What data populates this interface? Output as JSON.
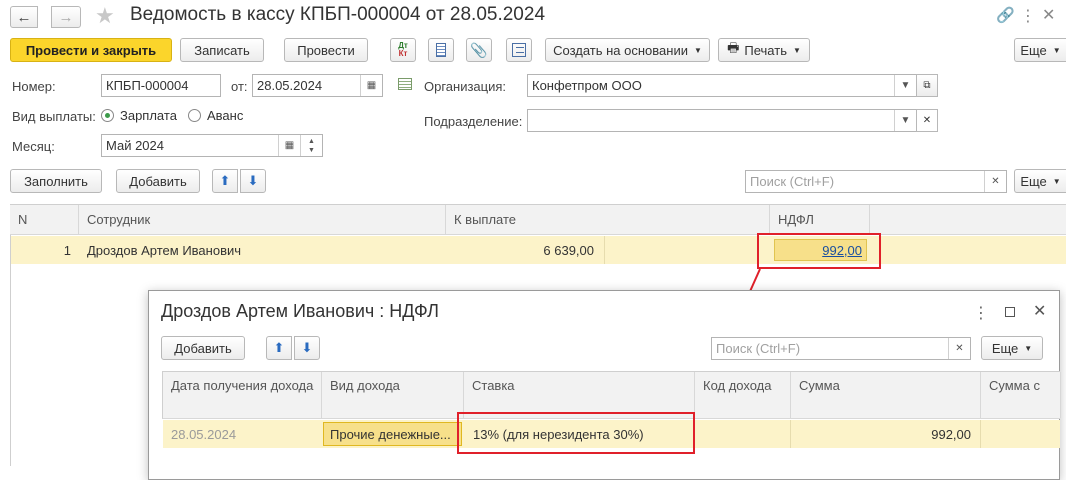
{
  "window": {
    "title": "Ведомость в кассу КПБП-000004 от 28.05.2024"
  },
  "toolbar": {
    "post_close": "Провести и закрыть",
    "save": "Записать",
    "post": "Провести",
    "dt_kt_top": "Дт",
    "dt_kt_bottom": "Кт",
    "create_based": "Создать на основании",
    "print": "Печать",
    "more": "Еще"
  },
  "form": {
    "number_label": "Номер:",
    "number_value": "КПБП-000004",
    "date_label": "от:",
    "date_value": "28.05.2024",
    "org_label": "Организация:",
    "org_value": "Конфетпром ООО",
    "payment_type_label": "Вид выплаты:",
    "payment_options": [
      "Зарплата",
      "Аванс"
    ],
    "department_label": "Подразделение:",
    "department_value": "",
    "month_label": "Месяц:",
    "month_value": "Май 2024"
  },
  "table_toolbar": {
    "fill": "Заполнить",
    "add": "Добавить",
    "search_placeholder": "Поиск (Ctrl+F)",
    "more": "Еще"
  },
  "table": {
    "columns": [
      "N",
      "Сотрудник",
      "К выплате",
      "НДФЛ"
    ],
    "rows": [
      {
        "n": "1",
        "employee": "Дроздов Артем Иванович",
        "to_pay": "6 639,00",
        "ndfl": "992,00"
      }
    ]
  },
  "dialog": {
    "title": "Дроздов Артем Иванович : НДФЛ",
    "add": "Добавить",
    "search_placeholder": "Поиск (Ctrl+F)",
    "more": "Еще",
    "columns": [
      "Дата получения дохода",
      "Вид дохода",
      "Ставка",
      "Код дохода",
      "Сумма",
      "Сумма с"
    ],
    "rows": [
      {
        "date": "28.05.2024",
        "income_type": "Прочие денежные...",
        "rate": "13% (для нерезидента 30%)",
        "code": "",
        "sum": "992,00"
      }
    ]
  },
  "colors": {
    "primary_button": "#fbd52b",
    "selected_row": "#fcf3c9",
    "highlight_red": "#e0202a",
    "radio_green": "#3c9a4a"
  }
}
